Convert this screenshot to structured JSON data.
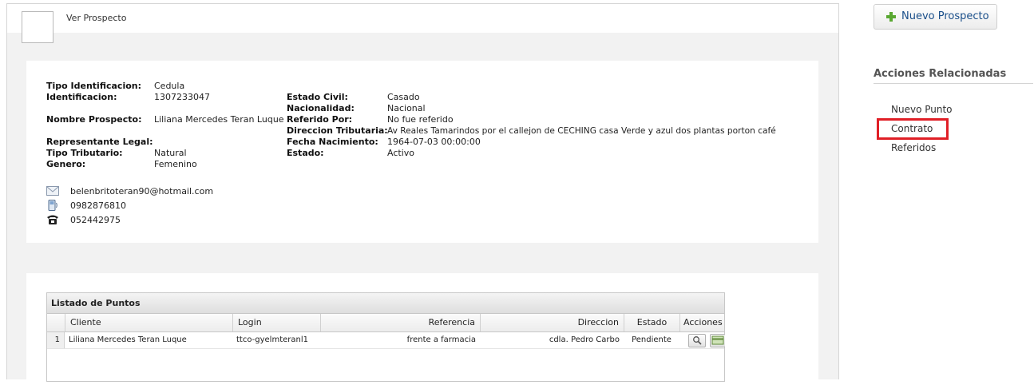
{
  "header": {
    "title": "Ver Prospecto"
  },
  "prospect": {
    "left": [
      {
        "label": "Tipo Identificacion:",
        "value": "Cedula"
      },
      {
        "label": "Identificacion:",
        "value": "1307233047"
      },
      {
        "label": "Nombre Prospecto:",
        "value": "Liliana Mercedes Teran Luque"
      },
      {
        "label": "Representante Legal:",
        "value": ""
      },
      {
        "label": "Tipo Tributario:",
        "value": "Natural"
      },
      {
        "label": "Genero:",
        "value": "Femenino"
      }
    ],
    "right": [
      {
        "label": "Estado Civil:",
        "value": "Casado"
      },
      {
        "label": "Nacionalidad:",
        "value": "Nacional"
      },
      {
        "label": "Referido Por:",
        "value": "No fue referido"
      },
      {
        "label": "Direccion Tributaria:",
        "value": "Av Reales Tamarindos por el callejon de CECHING casa Verde y azul dos plantas porton café"
      },
      {
        "label": "Fecha Nacimiento:",
        "value": "1964-07-03 00:00:00"
      },
      {
        "label": "Estado:",
        "value": "Activo"
      }
    ],
    "contacts": {
      "email": "belenbritoteran90@hotmail.com",
      "mobile": "0982876810",
      "phone": "052442975"
    },
    "contact_icons": [
      "email-icon",
      "mobile-phone-icon",
      "telephone-icon"
    ]
  },
  "list": {
    "title": "Listado de Puntos",
    "columns": [
      "Cliente",
      "Login",
      "Referencia",
      "Direccion",
      "Estado",
      "Acciones"
    ],
    "rows": [
      {
        "num": "1",
        "cliente": "Liliana Mercedes Teran Luque",
        "login": "ttco-gyelmteranl1",
        "referencia": "frente a farmacia",
        "direccion": "cdla. Pedro Carbo",
        "estado": "Pendiente"
      }
    ],
    "action_icons": [
      "magnifier-icon",
      "contract-icon"
    ]
  },
  "sidebar": {
    "new_button": "Nuevo Prospecto",
    "related_title": "Acciones Relacionadas",
    "items": [
      "Nuevo Punto",
      "Contrato",
      "Referidos"
    ],
    "highlighted_item": "Contrato",
    "highlight_color": "#e01f26"
  }
}
